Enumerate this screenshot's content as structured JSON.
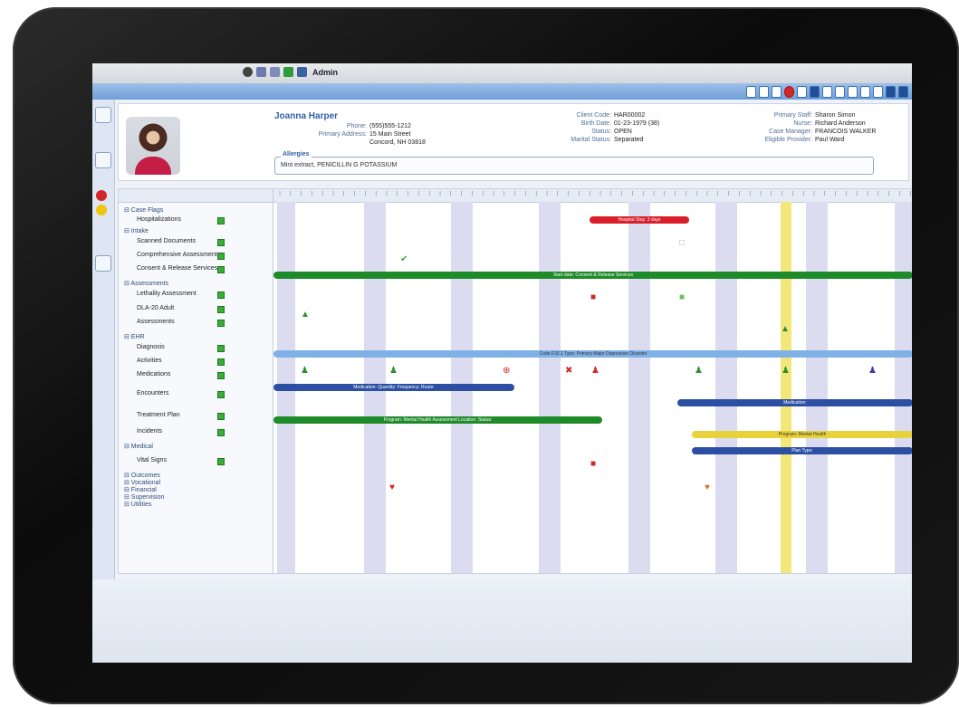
{
  "topbar": {
    "admin_label": "Admin"
  },
  "patient": {
    "name": "Joanna Harper",
    "left_fields": [
      {
        "label": "Phone:",
        "value": "(555)555-1212"
      },
      {
        "label": "Primary Address:",
        "value": "15 Main Street"
      },
      {
        "label": "",
        "value": "Concord, NH 03818"
      }
    ],
    "mid_fields": [
      {
        "label": "Client Code:",
        "value": "HAR00002"
      },
      {
        "label": "Birth Date:",
        "value": "01-23-1979 (38)"
      },
      {
        "label": "Status:",
        "value": "OPEN"
      },
      {
        "label": "Marital Status:",
        "value": "Separated"
      }
    ],
    "right_fields": [
      {
        "label": "Primary Staff:",
        "value": "Sharon Simon"
      },
      {
        "label": "Nurse:",
        "value": "Richard Anderson"
      },
      {
        "label": "Case Manager:",
        "value": "FRANCOIS WALKER"
      },
      {
        "label": "Eligible Provider:",
        "value": "Paul Ward"
      }
    ],
    "allergies_label": "Allergies",
    "allergies_text": "Mint extract, PENICILLIN G POTASSIUM"
  },
  "categories": [
    {
      "label": "Case Flags",
      "group": true
    },
    {
      "label": "Hospitalizations",
      "group": false,
      "square": true
    },
    {
      "label": "Intake",
      "group": true
    },
    {
      "label": "Scanned Documents",
      "group": false,
      "square": true
    },
    {
      "label": "Comprehensive Assessment",
      "group": false,
      "square": true
    },
    {
      "label": "Consent & Release Services",
      "group": false,
      "square": true
    },
    {
      "label": "Assessments",
      "group": true
    },
    {
      "label": "Lethality Assessment",
      "group": false,
      "square": true
    },
    {
      "label": "DLA-20 Adult",
      "group": false,
      "square": true
    },
    {
      "label": "Assessments",
      "group": false,
      "square": true
    },
    {
      "label": "EHR",
      "group": true
    },
    {
      "label": "Diagnosis",
      "group": false,
      "square": true
    },
    {
      "label": "Activities",
      "group": false,
      "square": true
    },
    {
      "label": "Medications",
      "group": false,
      "square": true
    },
    {
      "label": "Encounters",
      "group": false,
      "square": true
    },
    {
      "label": "Treatment Plan",
      "group": false,
      "square": true
    },
    {
      "label": "Incidents",
      "group": false,
      "square": true
    },
    {
      "label": "Medical",
      "group": true
    },
    {
      "label": "Vital Signs",
      "group": false,
      "square": true
    },
    {
      "label": "Outcomes",
      "group": true
    },
    {
      "label": "Vocational",
      "group": true
    },
    {
      "label": "Financial",
      "group": true
    },
    {
      "label": "Supervision",
      "group": true
    },
    {
      "label": "Utilities",
      "group": true
    }
  ],
  "timeline": {
    "bars": [
      {
        "label": "Hospital Stay: 3 days",
        "color": "#d81f2a"
      },
      {
        "label": "Start date: Consent & Release Services",
        "color": "#1f8a2a"
      },
      {
        "label": "Code F33.1 Type: Primary Major Depressive Disorder",
        "color": "#7fb1e6"
      },
      {
        "label": "Medication: Quantity: Frequency: Route:",
        "color": "#2c4fa3"
      },
      {
        "label": "Medication:",
        "color": "#2c4fa3"
      },
      {
        "label": "Program: Mental Health Assessment Location: Status:",
        "color": "#1f8a2a"
      },
      {
        "label": "Program: Mental Health",
        "color": "#e7d23b"
      },
      {
        "label": "Plan Type:",
        "color": "#2c4fa3"
      }
    ]
  },
  "colors": {
    "accent": "#2e5fa4",
    "today": "#f4e77a"
  }
}
